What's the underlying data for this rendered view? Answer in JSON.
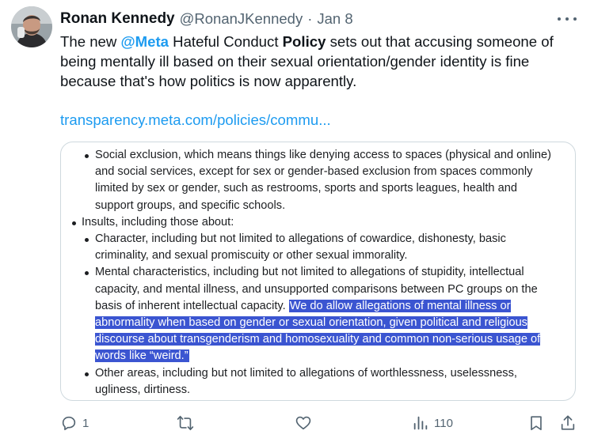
{
  "author": {
    "display_name": "Ronan Kennedy",
    "handle": "@RonanJKennedy",
    "separator": "·",
    "date": "Jan 8"
  },
  "tweet": {
    "text_parts": [
      "The new ",
      "@Meta",
      " Hateful Conduct ",
      "Policy",
      " sets out that accusing someone of being mentally ill based on their sexual orientation/gender identity is fine because that's how politics is now apparently."
    ],
    "link": "transparency.meta.com/policies/commu..."
  },
  "card": {
    "items": [
      {
        "level": 2,
        "text": "Social exclusion, which means things like denying access to spaces (physical and online) and social services, except for sex or gender-based exclusion from spaces commonly limited by sex or gender, such as restrooms, sports and sports leagues, health and support groups, and specific schools."
      },
      {
        "level": 1,
        "text": "Insults, including those about:"
      },
      {
        "level": 2,
        "text": "Character, including but not limited to allegations of cowardice, dishonesty, basic criminality, and sexual promiscuity or other sexual immorality."
      },
      {
        "level": 2,
        "text": "Mental characteristics, including but not limited to allegations of stupidity, intellectual capacity, and mental illness, and unsupported comparisons between PC groups on the basis of inherent intellectual capacity.",
        "highlight": "We do allow allegations of mental illness or abnormality when based on gender or sexual orientation, given political and religious discourse about transgenderism and homosexuality and common non-serious usage of words like “weird.”"
      },
      {
        "level": 2,
        "text": "Other areas, including but not limited to allegations of worthlessness, uselessness, ugliness, dirtiness."
      }
    ]
  },
  "actions": {
    "reply_count": "1",
    "retweet_count": "",
    "like_count": "",
    "views_count": "110"
  },
  "colors": {
    "link": "#1d9bf0",
    "highlight": "#3b55d1",
    "muted": "#536471",
    "border": "#cfd9de"
  },
  "icons": [
    "more-icon",
    "reply-icon",
    "retweet-icon",
    "like-icon",
    "views-icon",
    "bookmark-icon",
    "share-icon"
  ]
}
